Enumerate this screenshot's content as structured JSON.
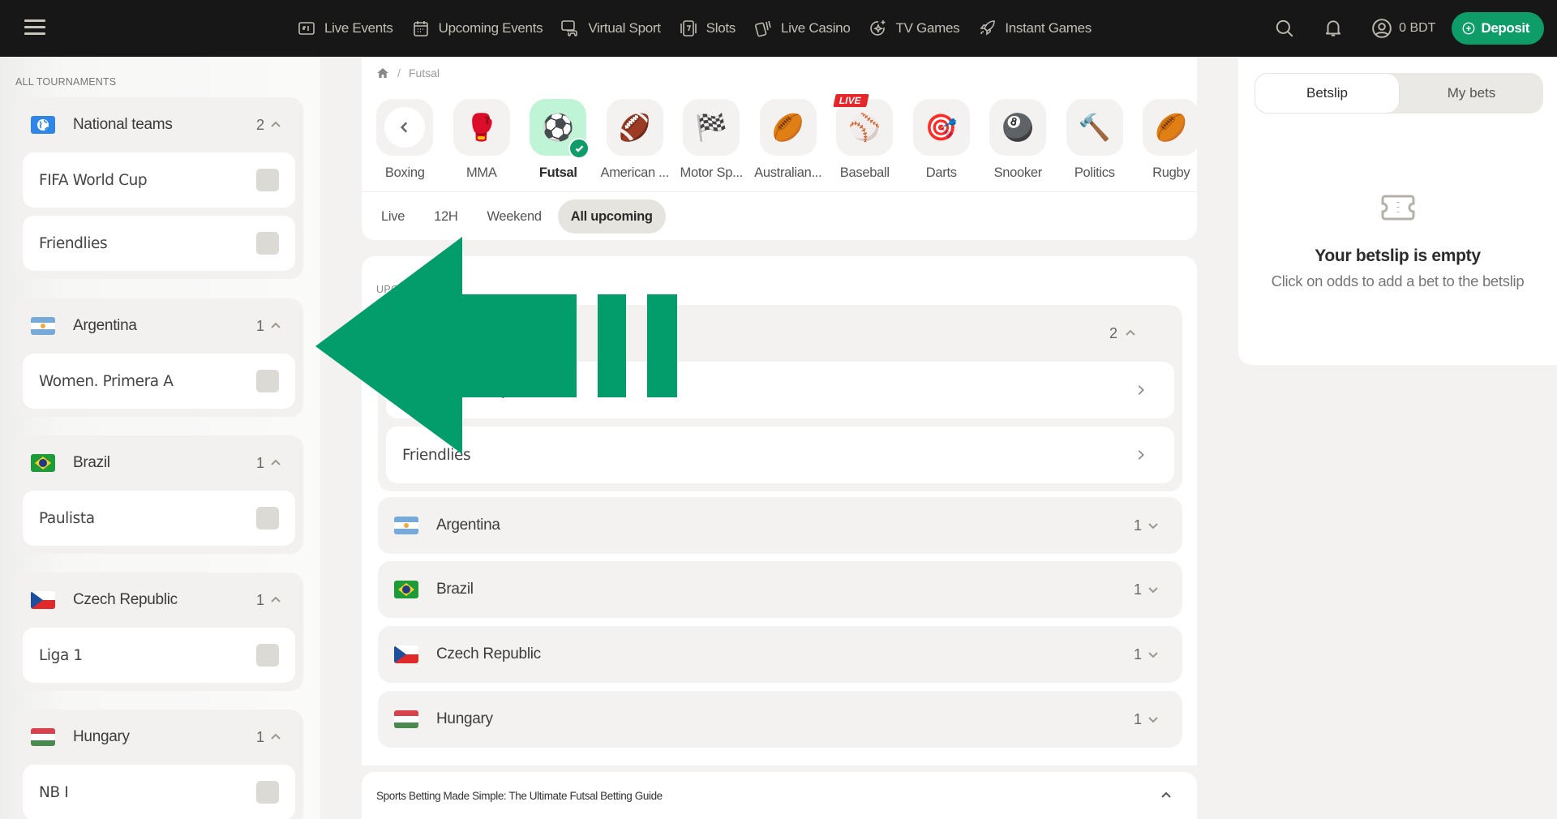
{
  "header": {
    "menu_icon": "hamburger-icon",
    "nav": [
      {
        "label": "Live Events",
        "icon": "scoreboard-icon"
      },
      {
        "label": "Upcoming Events",
        "icon": "calendar-icon"
      },
      {
        "label": "Virtual Sport",
        "icon": "gamepad-icon"
      },
      {
        "label": "Slots",
        "icon": "slot-icon"
      },
      {
        "label": "Live Casino",
        "icon": "cards-icon"
      },
      {
        "label": "TV Games",
        "icon": "sparkle-icon"
      },
      {
        "label": "Instant Games",
        "icon": "rocket-icon"
      }
    ],
    "balance": "0 BDT",
    "deposit_label": "Deposit",
    "accent_color": "#0e9c69"
  },
  "sidebar": {
    "title": "ALL TOURNAMENTS",
    "groups": [
      {
        "name": "National teams",
        "flag": "globe",
        "count": "2",
        "leagues": [
          "FIFA World Cup",
          "Friendlies"
        ]
      },
      {
        "name": "Argentina",
        "flag": "ar",
        "count": "1",
        "leagues": [
          "Women. Primera A"
        ]
      },
      {
        "name": "Brazil",
        "flag": "br",
        "count": "1",
        "leagues": [
          "Paulista"
        ]
      },
      {
        "name": "Czech Republic",
        "flag": "cz",
        "count": "1",
        "leagues": [
          "Liga 1"
        ]
      },
      {
        "name": "Hungary",
        "flag": "hu",
        "count": "1",
        "leagues": [
          "NB I"
        ]
      }
    ]
  },
  "breadcrumb": {
    "home_icon": "home-icon",
    "current": "Futsal"
  },
  "sports": [
    {
      "label": "Boxing",
      "icon": "back-arrow",
      "emoji": ""
    },
    {
      "label": "MMA",
      "emoji": "🥊"
    },
    {
      "label": "Futsal",
      "emoji": "⚽",
      "active": true
    },
    {
      "label": "American ...",
      "emoji": "🏈"
    },
    {
      "label": "Motor Sp...",
      "emoji": "🏁"
    },
    {
      "label": "Australian...",
      "emoji": "🏉"
    },
    {
      "label": "Baseball",
      "emoji": "⚾",
      "badge": "LIVE"
    },
    {
      "label": "Darts",
      "emoji": "🎯"
    },
    {
      "label": "Snooker",
      "emoji": "🎱"
    },
    {
      "label": "Politics",
      "emoji": "🔨"
    },
    {
      "label": "Rugby",
      "emoji": "🏉"
    }
  ],
  "time_filters": [
    {
      "label": "Live"
    },
    {
      "label": "12H"
    },
    {
      "label": "Weekend"
    },
    {
      "label": "All upcoming",
      "active": true
    }
  ],
  "main": {
    "section_title": "UPCOMING",
    "national_teams": {
      "count": "2",
      "leagues": [
        "FIFA World Cup",
        "Friendlies"
      ]
    },
    "countries": [
      {
        "name": "Argentina",
        "flag": "ar",
        "count": "1"
      },
      {
        "name": "Brazil",
        "flag": "br",
        "count": "1"
      },
      {
        "name": "Czech Republic",
        "flag": "cz",
        "count": "1"
      },
      {
        "name": "Hungary",
        "flag": "hu",
        "count": "1"
      }
    ],
    "guide_title": "Sports Betting Made Simple: The Ultimate Futsal Betting Guide"
  },
  "betslip": {
    "tabs": [
      {
        "label": "Betslip",
        "active": true
      },
      {
        "label": "My bets"
      }
    ],
    "empty_title": "Your betslip is empty",
    "empty_subtitle": "Click on odds to add a bet to the betslip"
  },
  "overlay": {
    "type": "arrow-left",
    "color": "#039c6b"
  }
}
